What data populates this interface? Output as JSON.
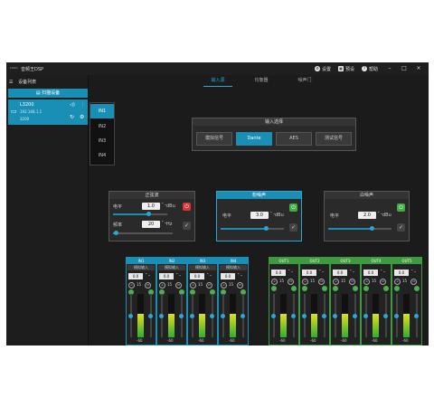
{
  "titlebar": {
    "logo": "LOGO",
    "title": "音频王DSP",
    "settings": "设置",
    "presets": "预设",
    "help": "帮助",
    "minimize": "–",
    "maximize": "□",
    "close": "×"
  },
  "sidebar": {
    "title": "设备列表",
    "scan": "扫描设备",
    "device": {
      "name": "L3200",
      "ip": "192.168.1.1",
      "model": "3200"
    }
  },
  "tabs": [
    "输入源",
    "均衡器",
    "噪声门"
  ],
  "input_list": [
    "IN1",
    "IN2",
    "IN3",
    "IN4"
  ],
  "input_select": {
    "title": "输入选择",
    "options": [
      "模拟信号",
      "Dante",
      "AES",
      "测试信号"
    ],
    "selected": "Dante"
  },
  "sine": {
    "title": "正弦波",
    "level_label": "电平",
    "level_value": "1.0",
    "level_unit": "dBu",
    "freq_label": "频率",
    "freq_value": "20",
    "freq_unit": "Hz",
    "level_fill": 0.65,
    "freq_fill": 0.05
  },
  "pink": {
    "title": "粉噪声",
    "level_label": "电平",
    "level_value": "3.0",
    "level_unit": "dBu",
    "level_fill": 0.72
  },
  "white": {
    "title": "白噪声",
    "level_label": "电平",
    "level_value": "2.0",
    "level_unit": "dBu",
    "level_fill": 0.68
  },
  "inputs": [
    {
      "name": "IN1",
      "mode": "模拟输入",
      "gain": "0.0",
      "val": "15",
      "min": "-60",
      "level": 0.55
    },
    {
      "name": "IN2",
      "mode": "模拟输入",
      "gain": "0.0",
      "val": "15",
      "min": "-60",
      "level": 0.55
    },
    {
      "name": "IN3",
      "mode": "模拟输入",
      "gain": "0.0",
      "val": "15",
      "min": "-60",
      "level": 0.55
    },
    {
      "name": "IN4",
      "mode": "模拟输入",
      "gain": "0.0",
      "val": "15",
      "min": "-60",
      "level": 0.55
    }
  ],
  "outputs": [
    {
      "name": "OUT1",
      "gain": "0.0",
      "val": "15",
      "min": "-60",
      "level": 0.55
    },
    {
      "name": "OUT2",
      "gain": "0.0",
      "val": "15",
      "min": "-60",
      "level": 0.55
    },
    {
      "name": "OUT3",
      "gain": "0.0",
      "val": "15",
      "min": "-60",
      "level": 0.55
    },
    {
      "name": "OUT4",
      "gain": "0.0",
      "val": "15",
      "min": "-60",
      "level": 0.55
    },
    {
      "name": "OUT5",
      "gain": "0.0",
      "val": "15",
      "min": "-60",
      "level": 0.55
    }
  ],
  "colors": {
    "accent": "#1a8fb5",
    "in_header": "#1a8fb5",
    "out_header": "#3e9a3e",
    "power_on": "#3fae3f",
    "power_off": "#d33"
  }
}
